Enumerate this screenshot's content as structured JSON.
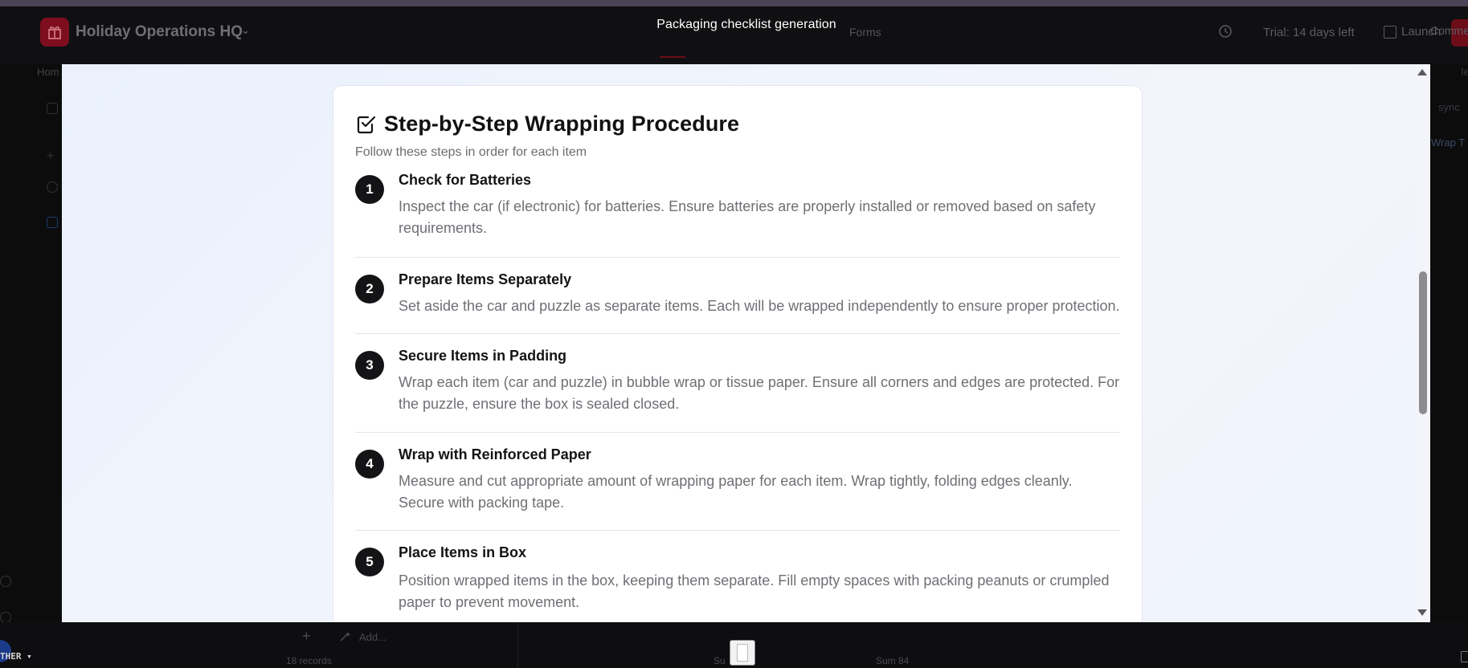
{
  "app": {
    "base_name": "Holiday Operations HQ",
    "forms_tab": "Forms",
    "trial_label": "Trial: 14 days left",
    "launch_label": "Launch",
    "comment_label": "Comme",
    "home_fragment": "Hom",
    "left_fragment": "",
    "right_fragments": {
      "sync": "sync",
      "wrap": "Wrap T",
      "ie": "Ie"
    },
    "bottom": {
      "add_label": "Add...",
      "records_label": "18 records",
      "sum_label": "Sum 84",
      "s_label": "Su",
      "weather_label": "THER"
    }
  },
  "modal": {
    "title": "Packaging checklist generation",
    "card": {
      "title": "Step-by-Step Wrapping Procedure",
      "subtitle": "Follow these steps in order for each item",
      "steps": [
        {
          "number": "1",
          "title": "Check for Batteries",
          "description": "Inspect the car (if electronic) for batteries. Ensure batteries are properly installed or removed based on safety requirements."
        },
        {
          "number": "2",
          "title": "Prepare Items Separately",
          "description": "Set aside the car and puzzle as separate items. Each will be wrapped independently to ensure proper protection."
        },
        {
          "number": "3",
          "title": "Secure Items in Padding",
          "description": "Wrap each item (car and puzzle) in bubble wrap or tissue paper. Ensure all corners and edges are protected. For the puzzle, ensure the box is sealed closed."
        },
        {
          "number": "4",
          "title": "Wrap with Reinforced Paper",
          "description": "Measure and cut appropriate amount of wrapping paper for each item. Wrap tightly, folding edges cleanly. Secure with packing tape."
        },
        {
          "number": "5",
          "title": "Place Items in Box",
          "description": "Position wrapped items in the box, keeping them separate. Fill empty spaces with packing peanuts or crumpled paper to prevent movement."
        }
      ]
    }
  }
}
